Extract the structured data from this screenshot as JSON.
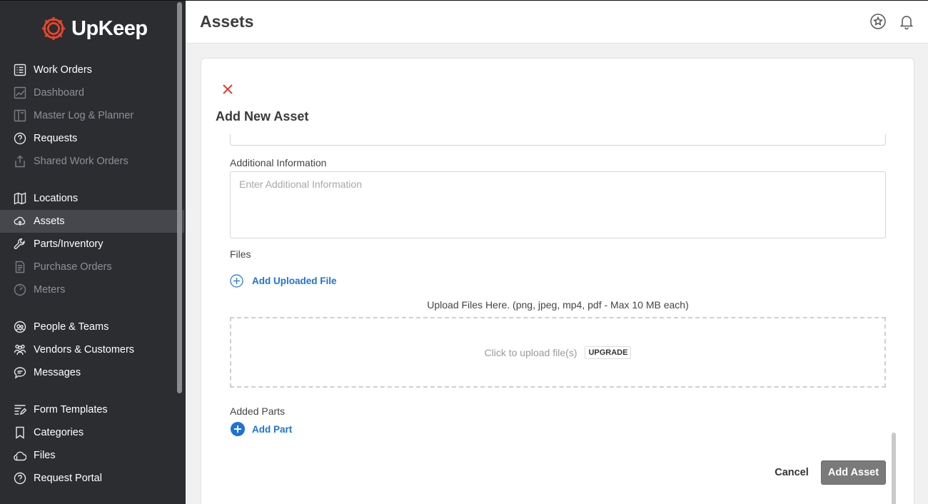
{
  "app": {
    "brand": "UpKeep",
    "brand_color": "#e8452c"
  },
  "sidebar": {
    "items": [
      {
        "label": "Work Orders",
        "icon": "list-icon",
        "state": "normal"
      },
      {
        "label": "Dashboard",
        "icon": "chart-icon",
        "state": "dim"
      },
      {
        "label": "Master Log & Planner",
        "icon": "planner-icon",
        "state": "dim"
      },
      {
        "label": "Requests",
        "icon": "question-icon",
        "state": "normal"
      },
      {
        "label": "Shared Work Orders",
        "icon": "share-icon",
        "state": "dim"
      },
      {
        "label": "Locations",
        "icon": "map-icon",
        "state": "normal"
      },
      {
        "label": "Assets",
        "icon": "asset-icon",
        "state": "active"
      },
      {
        "label": "Parts/Inventory",
        "icon": "wrench-icon",
        "state": "normal"
      },
      {
        "label": "Purchase Orders",
        "icon": "document-icon",
        "state": "dim"
      },
      {
        "label": "Meters",
        "icon": "meter-icon",
        "state": "dim"
      },
      {
        "label": "People & Teams",
        "icon": "people-icon",
        "state": "normal"
      },
      {
        "label": "Vendors & Customers",
        "icon": "vendors-icon",
        "state": "normal"
      },
      {
        "label": "Messages",
        "icon": "chat-icon",
        "state": "normal"
      },
      {
        "label": "Form Templates",
        "icon": "form-icon",
        "state": "normal"
      },
      {
        "label": "Categories",
        "icon": "bookmark-icon",
        "state": "normal"
      },
      {
        "label": "Files",
        "icon": "cloud-icon",
        "state": "normal"
      },
      {
        "label": "Request Portal",
        "icon": "question-icon",
        "state": "normal"
      }
    ]
  },
  "header": {
    "title": "Assets"
  },
  "modal": {
    "title": "Add New Asset",
    "additional_info_label": "Additional Information",
    "additional_info_placeholder": "Enter Additional Information",
    "files_label": "Files",
    "add_file_label": "Add Uploaded File",
    "upload_hint": "Upload Files Here. (png, jpeg, mp4, pdf - Max 10 MB each)",
    "dropzone_text": "Click to upload file(s)",
    "upgrade_label": "UPGRADE",
    "parts_label": "Added Parts",
    "add_part_label": "Add Part",
    "cancel_label": "Cancel",
    "submit_label": "Add Asset"
  }
}
